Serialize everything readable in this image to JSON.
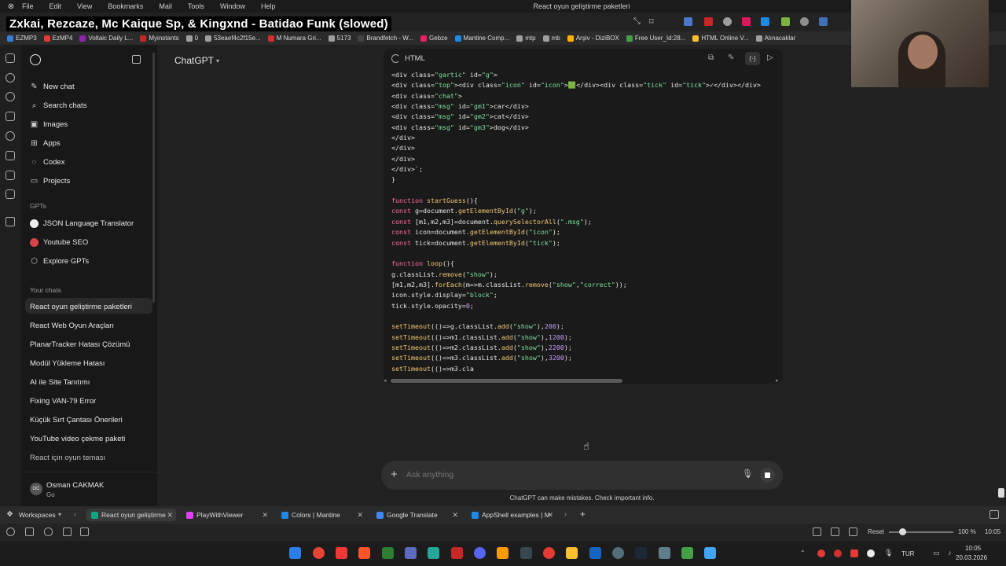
{
  "menubar": {
    "items": [
      "File",
      "Edit",
      "View",
      "Bookmarks",
      "Mail",
      "Tools",
      "Window",
      "Help"
    ],
    "window_title": "React oyun geliştirme paketleri"
  },
  "overlay": {
    "song_title": "Zxkai, Rezcaze, Mc Kaique Sp, & Kingxnd - Batidao Funk (slowed)"
  },
  "bookmarks": [
    {
      "label": "EZMP3",
      "color": "#3a7bd5"
    },
    {
      "label": "EzMP4",
      "color": "#e53935"
    },
    {
      "label": "Voltaic Daily L...",
      "color": "#8e24aa"
    },
    {
      "label": "Myinstants",
      "color": "#c62828"
    },
    {
      "label": "0",
      "color": "#9e9e9e"
    },
    {
      "label": "53eaef4c2f15e...",
      "color": "#9e9e9e"
    },
    {
      "label": "M Numara Gri...",
      "color": "#d32f2f"
    },
    {
      "label": "5173",
      "color": "#9e9e9e"
    },
    {
      "label": "Brandfetch - W...",
      "color": "#444444"
    },
    {
      "label": "Gebze",
      "color": "#e91e63"
    },
    {
      "label": "Mantine Comp...",
      "color": "#1e88e5"
    },
    {
      "label": "mtp",
      "color": "#9e9e9e"
    },
    {
      "label": "mb",
      "color": "#9e9e9e"
    },
    {
      "label": "Arşiv - DiziBOX",
      "color": "#ffb300"
    },
    {
      "label": "Free User_Id:28...",
      "color": "#43a047"
    },
    {
      "label": "HTML Online V...",
      "color": "#fbc02d"
    },
    {
      "label": "Alınacaklar",
      "color": "#9e9e9e"
    }
  ],
  "sidebar": {
    "nav": [
      {
        "label": "New chat",
        "icon": "new-chat-icon"
      },
      {
        "label": "Search chats",
        "icon": "search-icon"
      },
      {
        "label": "Images",
        "icon": "image-icon"
      },
      {
        "label": "Apps",
        "icon": "apps-icon"
      },
      {
        "label": "Codex",
        "icon": "codex-icon"
      },
      {
        "label": "Projects",
        "icon": "folder-icon"
      }
    ],
    "gpts_heading": "GPTs",
    "gpts": [
      "JSON Language Translator",
      "Youtube SEO",
      "Explore GPTs"
    ],
    "chats_heading": "Your chats",
    "chats": [
      "React oyun geliştirme paketleri",
      "React Web Oyun Araçları",
      "PlanarTracker Hatası Çözümü",
      "Modül Yükleme Hatası",
      "AI ile Site Tanıtımı",
      "Fixing VAN-79 Error",
      "Küçük Sırt Çantası Önerileri",
      "YouTube video çekme paketi",
      "React için oyun teması"
    ],
    "user": {
      "name": "Osman CAKMAK",
      "plan": "Go",
      "initials": "OC"
    }
  },
  "header": {
    "model_label": "ChatGPT"
  },
  "code_panel": {
    "language": "HTML",
    "lines": [
      "<div class=\"gartic\" id=\"g\">",
      "<div class=\"top\"><div class=\"icon\" id=\"icon\">🟩</div><div class=\"tick\" id=\"tick\">✓</div></div>",
      "<div class=\"chat\">",
      "<div class=\"msg\" id=\"gm1\">car</div>",
      "<div class=\"msg\" id=\"gm2\">cat</div>",
      "<div class=\"msg\" id=\"gm3\">dog</div>",
      "</div>",
      "</div>",
      "</div>",
      "</div>`;",
      "}",
      "",
      "function startGuess(){",
      "const g=document.getElementById(\"g\");",
      "const [m1,m2,m3]=document.querySelectorAll(\".msg\");",
      "const icon=document.getElementById(\"icon\");",
      "const tick=document.getElementById(\"tick\");",
      "",
      "function loop(){",
      "g.classList.remove(\"show\");",
      "[m1,m2,m3].forEach(m=>m.classList.remove(\"show\",\"correct\"));",
      "icon.style.display=\"block\";",
      "tick.style.opacity=0;",
      "",
      "setTimeout(()=>g.classList.add(\"show\"),200);",
      "setTimeout(()=>m1.classList.add(\"show\"),1200);",
      "setTimeout(()=>m2.classList.add(\"show\"),2200);",
      "setTimeout(()=>m3.classList.add(\"show\"),3200);",
      "setTimeout(()=>m3.cla"
    ]
  },
  "composer": {
    "placeholder": "Ask anything",
    "disclaimer": "ChatGPT can make mistakes. Check important info."
  },
  "tabs": {
    "workspaces_label": "Workspaces",
    "items": [
      {
        "label": "React oyun geliştirme",
        "active": true,
        "color": "#10a37f"
      },
      {
        "label": "PlayWithViewer",
        "active": false,
        "color": "#e040fb"
      },
      {
        "label": "Colors | Mantine",
        "active": false,
        "color": "#1e88e5"
      },
      {
        "label": "Google Translate",
        "active": false,
        "color": "#4285f4"
      },
      {
        "label": "AppShell examples | M",
        "active": false,
        "color": "#1e88e5"
      }
    ]
  },
  "status": {
    "reset_label": "Reset",
    "zoom": "100 %",
    "time_right": "10:05"
  },
  "taskbar": {
    "language": "TUR",
    "time": "10:05",
    "date": "20.03.2026"
  }
}
